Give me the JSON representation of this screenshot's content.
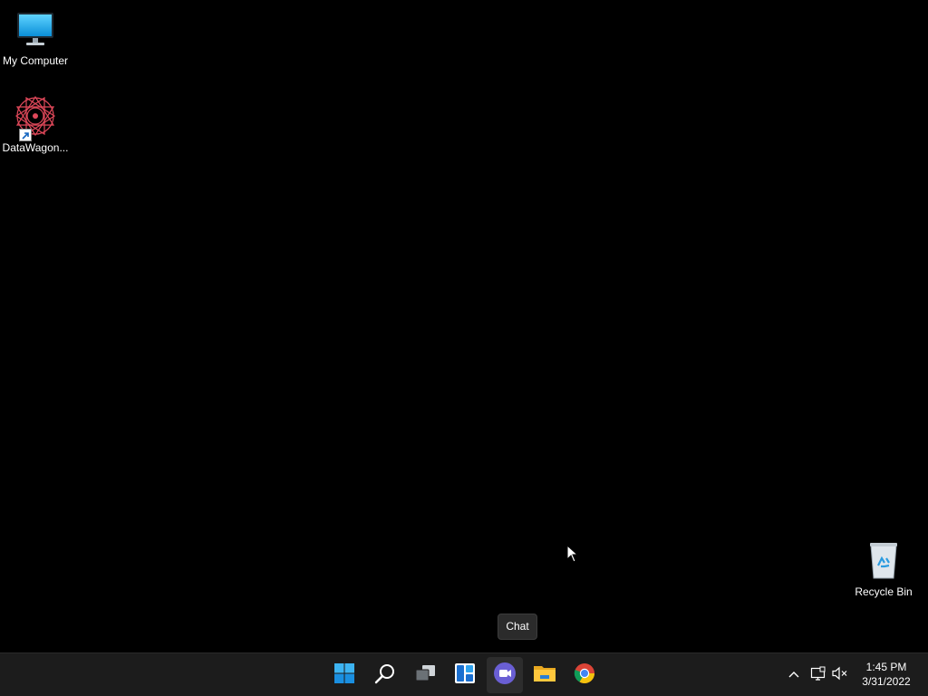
{
  "desktop": {
    "icons": [
      {
        "label": "My Computer",
        "icon": "monitor-icon"
      },
      {
        "label": "DataWagon...",
        "icon": "datawagon-app-icon"
      },
      {
        "label": "Recycle Bin",
        "icon": "recycle-bin-icon"
      }
    ]
  },
  "tooltip": {
    "text": "Chat"
  },
  "taskbar": {
    "buttons": [
      {
        "name": "Start",
        "icon": "windows-logo-icon"
      },
      {
        "name": "Search",
        "icon": "search-icon"
      },
      {
        "name": "Task View",
        "icon": "task-view-icon"
      },
      {
        "name": "Widgets",
        "icon": "widgets-icon"
      },
      {
        "name": "Chat",
        "icon": "chat-icon",
        "state": "hover"
      },
      {
        "name": "File Explorer",
        "icon": "folder-icon"
      },
      {
        "name": "Google Chrome",
        "icon": "chrome-icon"
      }
    ],
    "tray": {
      "icons": [
        "chevron-up-icon",
        "network-icon",
        "volume-muted-icon"
      ],
      "time": "1:45 PM",
      "date": "3/31/2022"
    }
  },
  "colors": {
    "desktop_background": "#000000",
    "taskbar_background": "#1c1c1c",
    "accent": "#0078d4"
  }
}
